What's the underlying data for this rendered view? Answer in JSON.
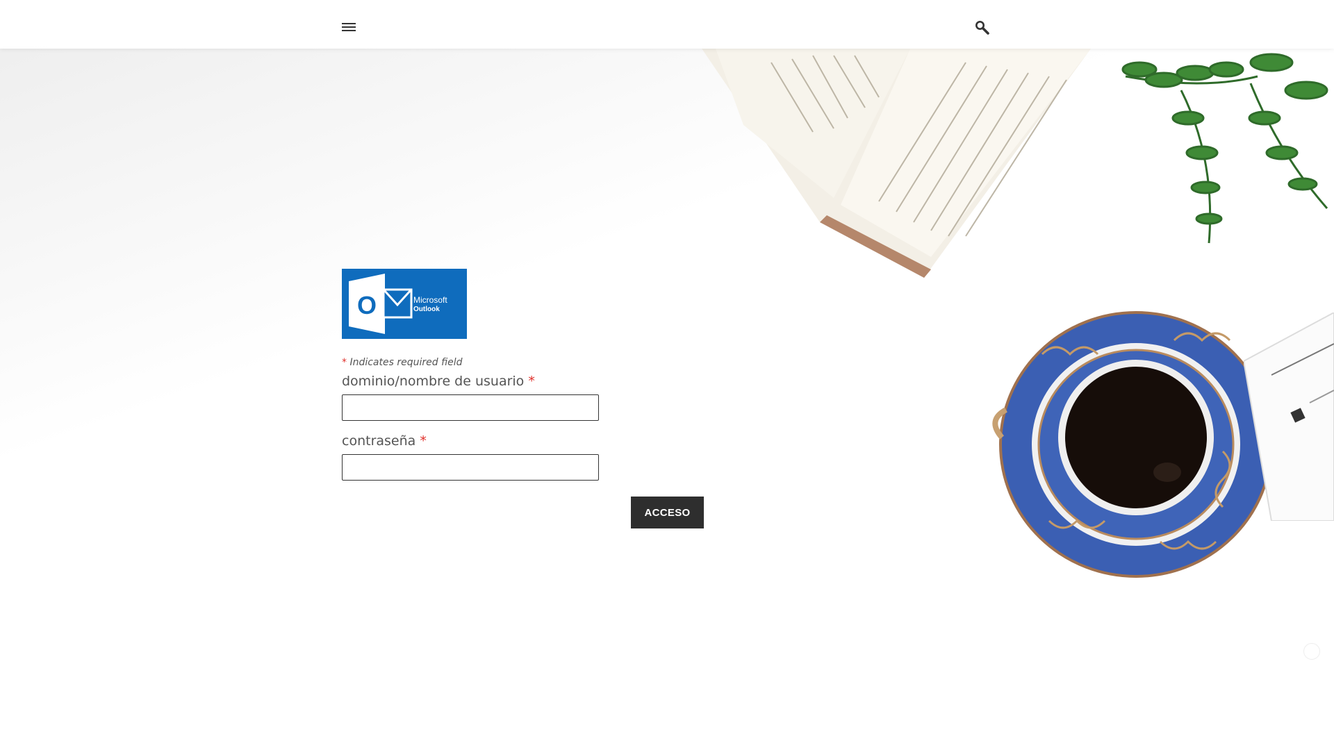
{
  "header": {
    "menu_icon": "hamburger-menu-icon",
    "search_icon": "search-icon"
  },
  "logo": {
    "brand_letter": "O",
    "brand_line1": "Microsoft",
    "brand_line2": "Outlook",
    "color": "#0f6cbd"
  },
  "form": {
    "required_asterisk": "*",
    "required_note": " Indicates required field",
    "username_label": "dominio/nombre de usuario",
    "username_value": "",
    "password_label": "contraseña",
    "password_value": "",
    "submit_label": "ACCESO"
  },
  "colors": {
    "required": "#e0302b",
    "button": "#2e2e2e"
  }
}
